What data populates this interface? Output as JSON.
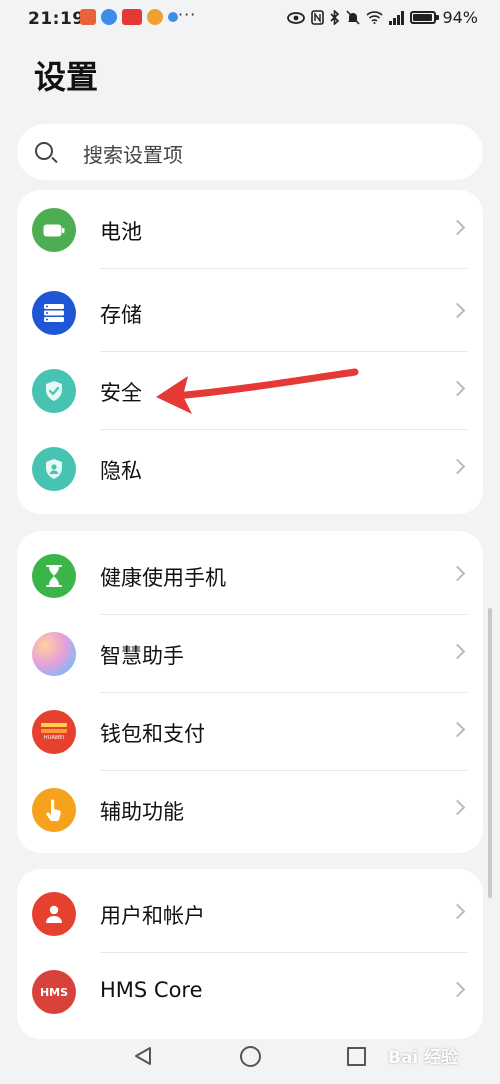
{
  "status_bar": {
    "time": "21:19",
    "more": "···",
    "battery_text": "94%",
    "battery_level": 0.94
  },
  "header": {
    "title": "设置"
  },
  "search": {
    "placeholder": "搜索设置项"
  },
  "groups": [
    {
      "items": [
        {
          "label": "电池",
          "icon": "battery-icon",
          "color": "#4cae50"
        },
        {
          "label": "存储",
          "icon": "storage-icon",
          "color": "#1e56d6"
        },
        {
          "label": "安全",
          "icon": "shield-check-icon",
          "color": "#47c3b2"
        },
        {
          "label": "隐私",
          "icon": "privacy-icon",
          "color": "#47c3b2"
        }
      ]
    },
    {
      "items": [
        {
          "label": "健康使用手机",
          "icon": "hourglass-icon",
          "color": "#3bb54a"
        },
        {
          "label": "智慧助手",
          "icon": "assistant-icon",
          "color": "#c69be0"
        },
        {
          "label": "钱包和支付",
          "icon": "wallet-icon",
          "color": "#e5412e",
          "icon_text": "HUAWEI"
        },
        {
          "label": "辅助功能",
          "icon": "hand-icon",
          "color": "#f5a21c"
        }
      ]
    },
    {
      "items": [
        {
          "label": "用户和帐户",
          "icon": "user-icon",
          "color": "#e5412e"
        },
        {
          "label": "HMS Core",
          "icon": "hms-icon",
          "color": "#d8423a",
          "icon_text": "HMS"
        }
      ]
    }
  ],
  "annotation": {
    "color": "#e53935"
  },
  "watermark": {
    "text": "Bai 经验"
  }
}
